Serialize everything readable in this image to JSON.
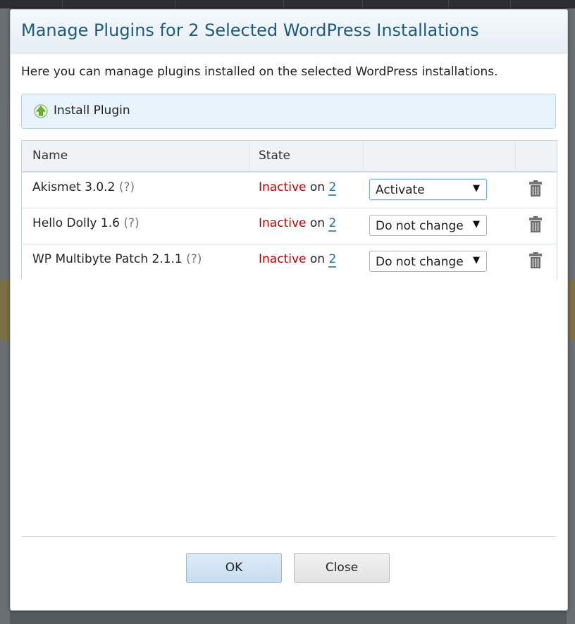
{
  "dialog": {
    "title": "Manage Plugins for 2 Selected WordPress Installations",
    "description": "Here you can manage plugins installed on the selected WordPress installations."
  },
  "install": {
    "label": "Install Plugin",
    "icon": "install-arrow-icon"
  },
  "table": {
    "headers": {
      "name": "Name",
      "state": "State"
    },
    "rows": [
      {
        "name": "Akismet 3.0.2",
        "help": "(?)",
        "state": "Inactive",
        "on": "on",
        "count": "2",
        "action": "Activate"
      },
      {
        "name": "Hello Dolly 1.6",
        "help": "(?)",
        "state": "Inactive",
        "on": "on",
        "count": "2",
        "action": "Do not change"
      },
      {
        "name": "WP Multibyte Patch 2.1.1",
        "help": "(?)",
        "state": "Inactive",
        "on": "on",
        "count": "2",
        "action": "Do not change"
      }
    ]
  },
  "buttons": {
    "ok": "OK",
    "close": "Close"
  },
  "colors": {
    "title": "#1e5a80",
    "inactive": "#b80000",
    "link": "#1f6fb0"
  }
}
